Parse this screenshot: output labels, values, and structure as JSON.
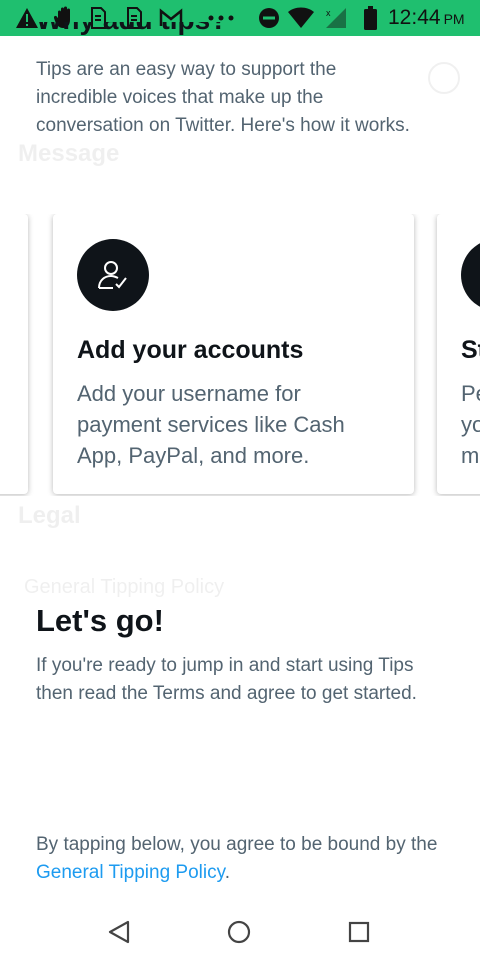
{
  "status_bar": {
    "time": "12:44",
    "ampm": "PM",
    "icons": [
      "warning-icon",
      "hand-icon",
      "sim-card-icon",
      "sim-card-icon",
      "gmail-icon",
      "more-dots-icon",
      "do-not-disturb-icon",
      "wifi-icon",
      "cellular-signal-icon",
      "battery-icon"
    ]
  },
  "background": {
    "message_heading": "Message",
    "legal_heading": "Legal",
    "general_tipping_policy": "General Tipping Policy"
  },
  "sheet": {
    "title_partial": "Why add tips?",
    "intro": "Tips are an easy way to support the incredible voices that make up the conversation on Twitter. Here's how it works.",
    "cards": [
      {
        "icon": "person-check-icon",
        "title": "Add your accounts",
        "text": "Add your username for payment services like Cash App, PayPal, and more."
      },
      {
        "title_partial": "St",
        "text_partial": "Pe\nyo\nm"
      }
    ],
    "lets_go_title": "Let's go!",
    "ready_text": "If you're ready to jump in and start using Tips then read the Terms and agree to get started.",
    "consent_prefix": "By tapping below, you agree to be bound by the ",
    "consent_link": "General Tipping Policy",
    "consent_suffix": "."
  },
  "nav_bar": {
    "buttons": [
      "back-icon",
      "home-icon",
      "recents-icon"
    ]
  },
  "colors": {
    "status_bar": "#1fbf6f",
    "link": "#1d9bf0",
    "primary_text": "#0f1419",
    "secondary_text": "#536471"
  }
}
